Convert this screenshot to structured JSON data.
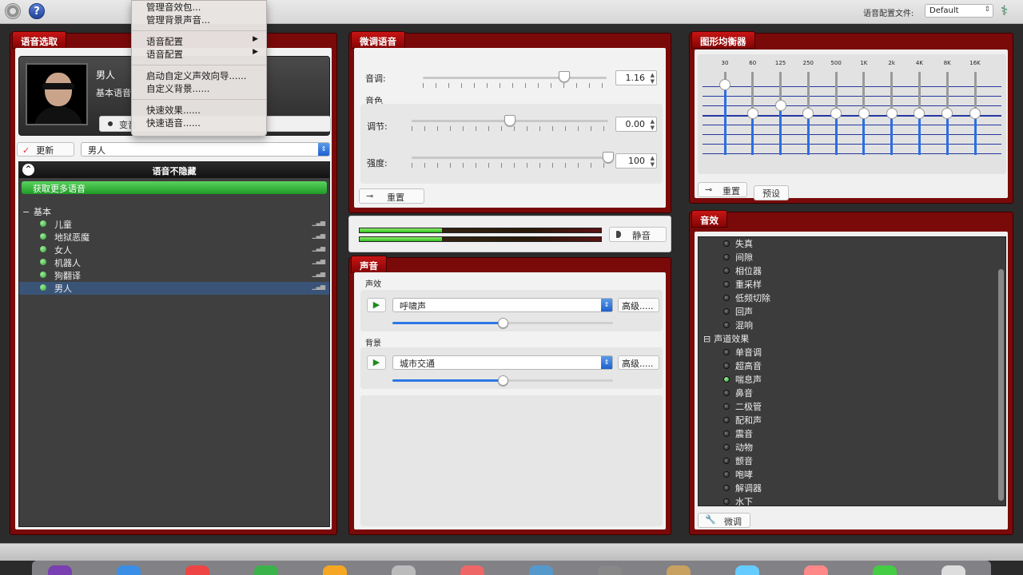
{
  "top_bar": {
    "config_label": "语音配置文件:",
    "config_value": "Default",
    "icons": [
      "gear-icon",
      "help-icon",
      "caduceus-icon"
    ]
  },
  "voice_panel": {
    "title": "语音选取",
    "voice_name": "男人",
    "voice_desc": "基本语音",
    "change_label": "变音",
    "update_label": "更新",
    "selected_voice": "男人",
    "list_header": "语音不隐藏",
    "get_more": "获取更多语音",
    "group": "基本",
    "items": [
      "儿童",
      "地狱恶魔",
      "女人",
      "机器人",
      "狗翻译",
      "男人"
    ],
    "selected_index": 5
  },
  "tune_panel": {
    "title": "微调语音",
    "pitch_label": "音调:",
    "pitch_value": "1.16",
    "pitch_pos": 0.77,
    "timbre_label": "音色",
    "adjust_label": "调节:",
    "adjust_value": "0.00",
    "adjust_pos": 0.5,
    "strength_label": "强度:",
    "strength_value": "100",
    "strength_pos": 1.0,
    "reset_label": "重置"
  },
  "meter": {
    "levels": [
      0.34,
      0.34
    ],
    "mute_label": "静音"
  },
  "sound_panel": {
    "title": "声音",
    "effect_label": "声效",
    "effect_value": "呼啸声",
    "effect_adv": "高级.....",
    "effect_level": 0.5,
    "bg_label": "背景",
    "bg_value": "城市交通",
    "bg_adv": "高级.....",
    "bg_level": 0.5
  },
  "eq_panel": {
    "title": "图形均衡器",
    "bands": [
      {
        "freq": "30",
        "level": 0.85
      },
      {
        "freq": "60",
        "level": 0.5
      },
      {
        "freq": "125",
        "level": 0.6
      },
      {
        "freq": "250",
        "level": 0.5
      },
      {
        "freq": "500",
        "level": 0.5
      },
      {
        "freq": "1K",
        "level": 0.5
      },
      {
        "freq": "2k",
        "level": 0.5
      },
      {
        "freq": "4K",
        "level": 0.5
      },
      {
        "freq": "8K",
        "level": 0.5
      },
      {
        "freq": "16K",
        "level": 0.5
      }
    ],
    "reset_label": "重置",
    "preset_label": "预设"
  },
  "fx_panel": {
    "title": "音效",
    "items_top": [
      "失真",
      "间隙",
      "相位器",
      "重采样",
      "低频切除",
      "回声",
      "混响"
    ],
    "group": "声道效果",
    "items": [
      "单音调",
      "超高音",
      "喘息声",
      "鼻音",
      "二极管",
      "配和声",
      "震音",
      "动物",
      "颤音",
      "咆哮",
      "解调器",
      "水下"
    ],
    "active_item": "喘息声",
    "tune_label": "微调"
  },
  "menu": {
    "items": [
      "管理音效包...",
      "管理背景声音...",
      "-",
      "语音配置",
      "语音配置",
      "-",
      "启动自定义声效向导......",
      "自定义背景......",
      "-",
      "快速效果......",
      "快速语音......"
    ],
    "submenus": [
      "语音配置"
    ]
  },
  "colors": {
    "panel": "#7a0a0a",
    "tab": "#b81010",
    "accent": "#2c78e6",
    "green": "#2fbf1f"
  }
}
